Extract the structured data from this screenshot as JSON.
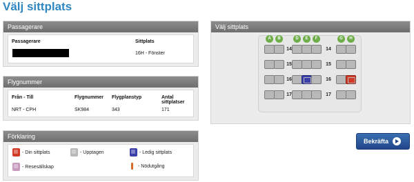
{
  "page": {
    "title": "Välj sittplats"
  },
  "passengers": {
    "heading": "Passagerare",
    "col_passenger": "Passagerare",
    "col_seat": "Sittplats",
    "rows": [
      {
        "seat": "16H - Fönster"
      }
    ]
  },
  "flight": {
    "heading": "Flygnummer",
    "col_route": "Från - Till",
    "col_number": "Flygnummer",
    "col_type": "Flygplanstyp",
    "col_seats": "Antal sittplatser",
    "route": "NRT - CPH",
    "number": "SK984",
    "type": "343",
    "seats": "171"
  },
  "legend": {
    "heading": "Förklaring",
    "items": [
      {
        "label": "- Din sittplats",
        "icon": "seat-mine-icon",
        "color": "#d23a28"
      },
      {
        "label": "- Upptagen",
        "icon": "seat-taken-icon",
        "color": "#b9b9b9"
      },
      {
        "label": "- Ledig sittplats",
        "icon": "seat-free-icon",
        "color": "#3b3fa8"
      },
      {
        "label": "- Resesällskap",
        "icon": "seat-companion-icon",
        "color": "#c79bbd"
      },
      {
        "label": "- Nödutgång",
        "icon": "exit-icon",
        "color": "#d96b2a"
      }
    ]
  },
  "seatmap": {
    "heading": "Välj sittplats",
    "columns": [
      "A",
      "B",
      "D",
      "E",
      "F",
      "G",
      "H"
    ],
    "rows": [
      "14",
      "15",
      "16",
      "17"
    ],
    "grid": [
      [
        "taken",
        "taken",
        "taken",
        "taken",
        "taken",
        "taken",
        "taken"
      ],
      [
        "taken",
        "taken",
        "taken",
        "taken",
        "taken",
        "taken",
        "taken"
      ],
      [
        "taken",
        "taken",
        "taken",
        "free",
        "taken",
        "taken",
        "mine"
      ],
      [
        "taken",
        "taken",
        "taken",
        "taken",
        "taken",
        "taken",
        "taken"
      ]
    ]
  },
  "actions": {
    "confirm": "Bekräfta"
  },
  "colors": {
    "accent": "#2f86c0",
    "button": "#21468a",
    "column_badge": "#6fae4a"
  }
}
